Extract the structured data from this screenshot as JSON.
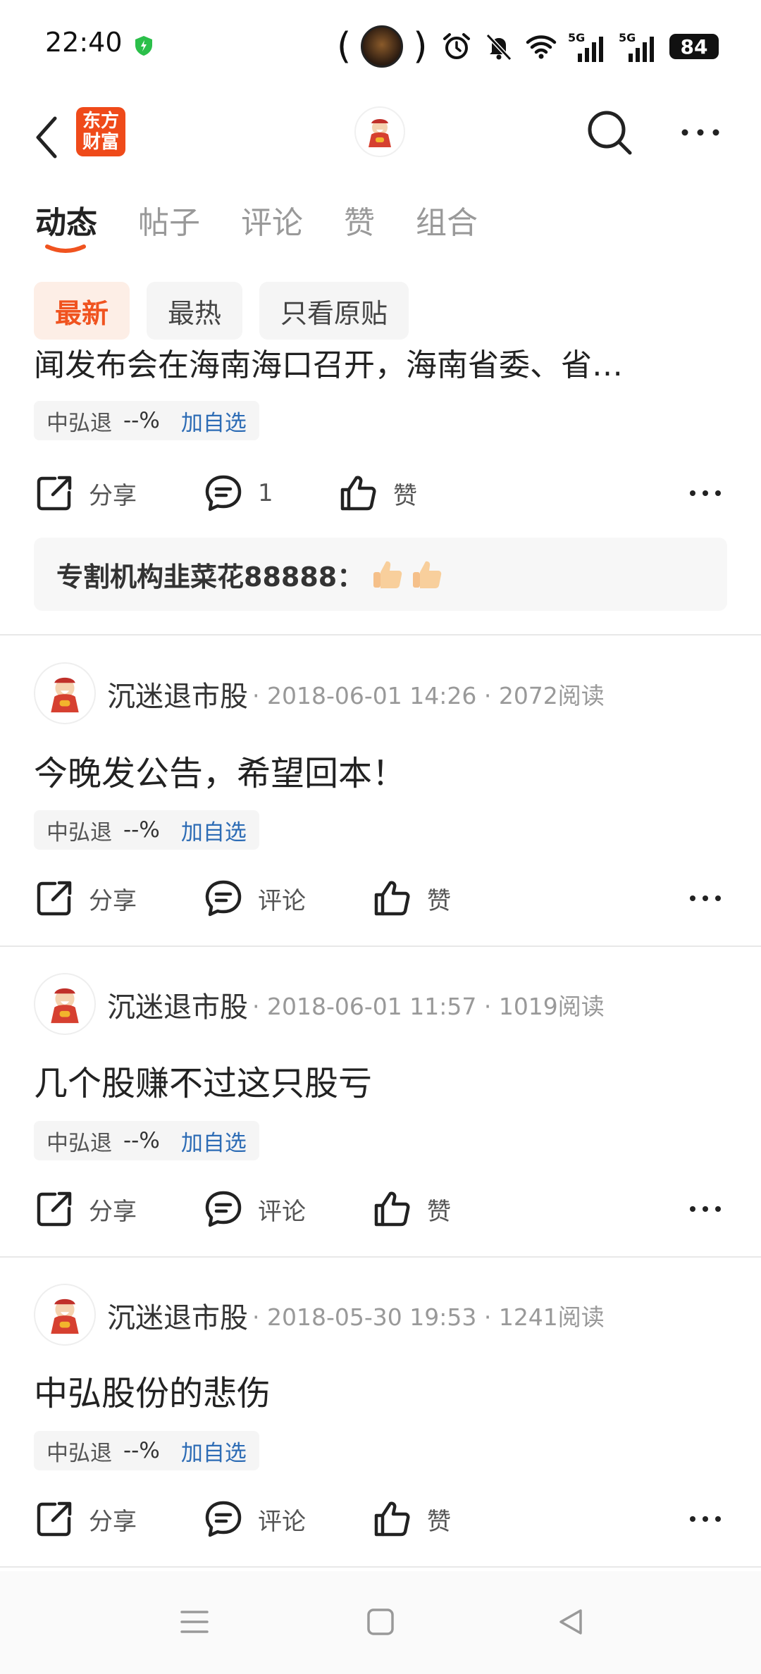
{
  "status_bar": {
    "time": "22:40",
    "battery": "84",
    "signal_label_1": "5G",
    "signal_label_2": "5G",
    "left_paren": "(",
    "right_paren": ")"
  },
  "header": {
    "logo_line1": "东方",
    "logo_line2": "财富"
  },
  "tabs": [
    {
      "label": "动态",
      "active": true
    },
    {
      "label": "帖子",
      "active": false
    },
    {
      "label": "评论",
      "active": false
    },
    {
      "label": "赞",
      "active": false
    },
    {
      "label": "组合",
      "active": false
    }
  ],
  "filters": [
    {
      "label": "最新",
      "active": true
    },
    {
      "label": "最热",
      "active": false
    },
    {
      "label": "只看原贴",
      "active": false
    }
  ],
  "top_post": {
    "clipped_text": "闻发布会在海南海口召开，海南省委、省…",
    "stock": {
      "name": "中弘退",
      "pct": "--%",
      "add": "加自选"
    },
    "actions": {
      "share": "分享",
      "comment": "1",
      "like": "赞"
    },
    "comment_preview": {
      "author": "专割机构韭菜花88888：",
      "emoji": "thumbs-up-icon"
    }
  },
  "posts": [
    {
      "username": "沉迷退市股",
      "meta": "· 2018-06-01 14:26 · 2072阅读",
      "title": "今晚发公告，希望回本！",
      "stock": {
        "name": "中弘退",
        "pct": "--%",
        "add": "加自选"
      },
      "actions": {
        "share": "分享",
        "comment": "评论",
        "like": "赞"
      }
    },
    {
      "username": "沉迷退市股",
      "meta": "· 2018-06-01 11:57 · 1019阅读",
      "title": "几个股赚不过这只股亏",
      "stock": {
        "name": "中弘退",
        "pct": "--%",
        "add": "加自选"
      },
      "actions": {
        "share": "分享",
        "comment": "评论",
        "like": "赞"
      }
    },
    {
      "username": "沉迷退市股",
      "meta": "· 2018-05-30 19:53 · 1241阅读",
      "title": "中弘股份的悲伤",
      "stock": {
        "name": "中弘退",
        "pct": "--%",
        "add": "加自选"
      },
      "actions": {
        "share": "分享",
        "comment": "评论",
        "like": "赞"
      }
    }
  ],
  "colors": {
    "accent": "#f0531f",
    "link": "#2d6cb5",
    "logo_bg": "#ef4a1a"
  }
}
